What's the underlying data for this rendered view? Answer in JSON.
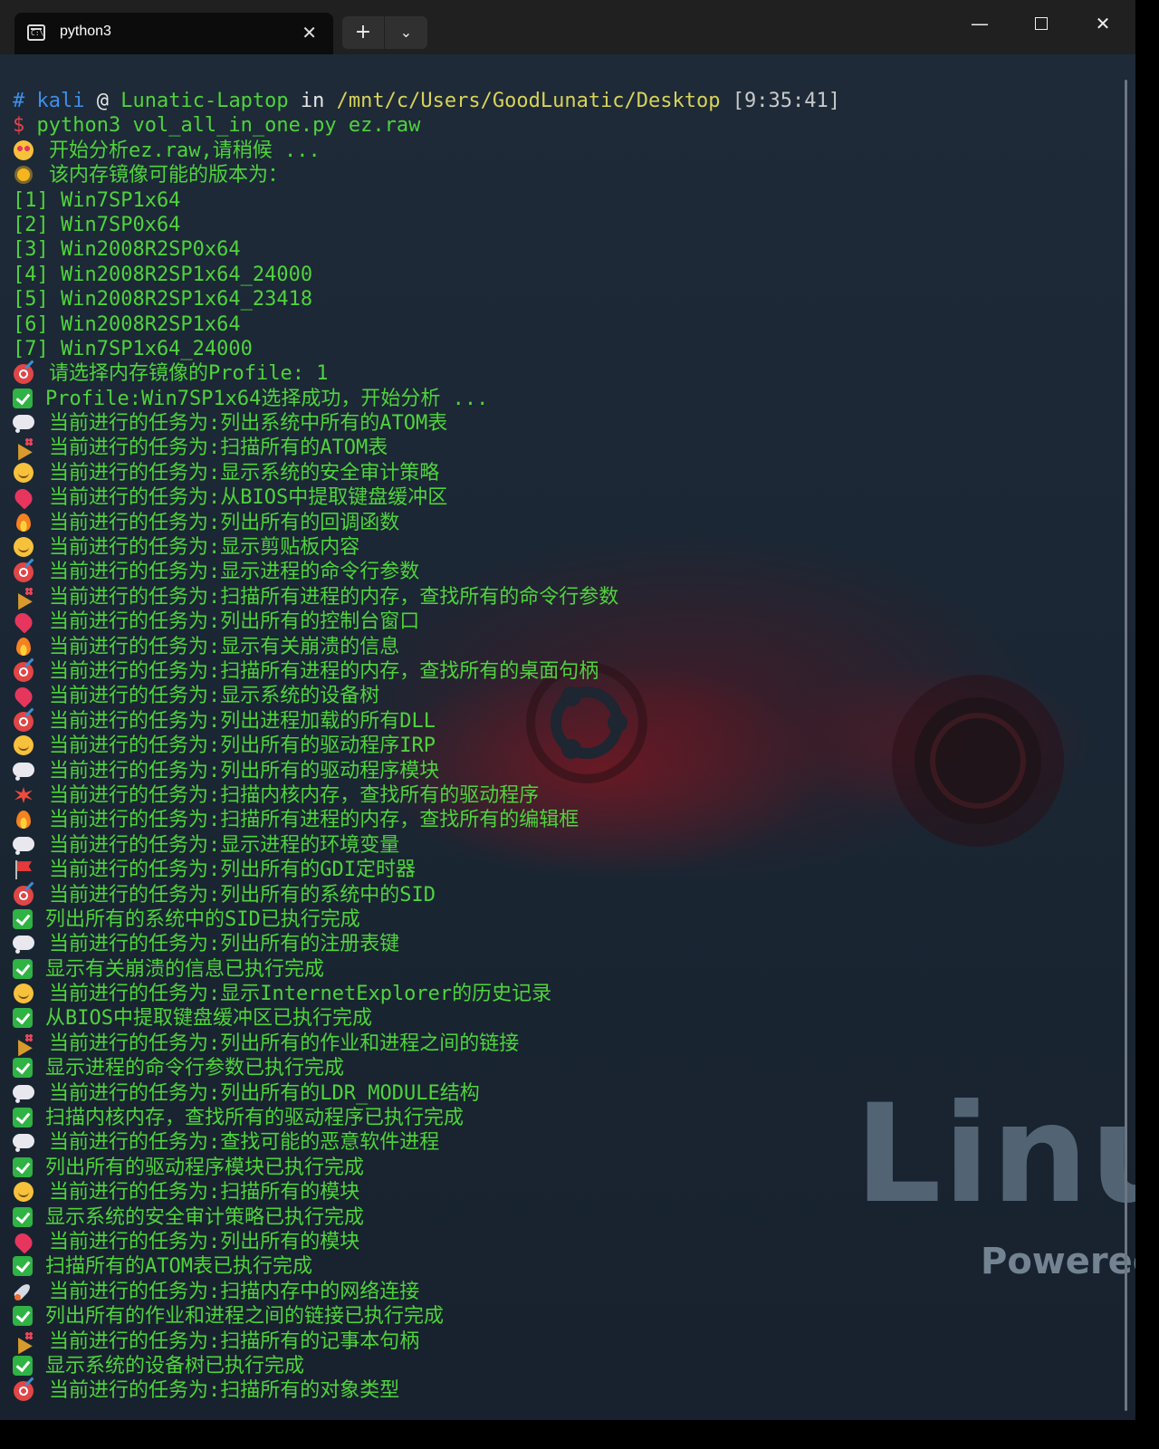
{
  "window": {
    "tab_title": "python3",
    "tab_icon_text": "C:\\",
    "new_tab_label": "+",
    "dropdown_label": "⌄",
    "close_tab_label": "✕",
    "minimize_label": "—",
    "close_label": "✕"
  },
  "wallpaper": {
    "line1": "Linux",
    "line2": "Powered"
  },
  "prompt": {
    "hash": "#",
    "user": "kali",
    "at": "@",
    "host": "Lunatic-Laptop",
    "in": "in",
    "path": "/mnt/c/Users/GoodLunatic/Desktop",
    "time": "[9:35:41]",
    "dollar": "$",
    "command": "python3 vol_all_in_one.py ez.raw"
  },
  "lines": [
    {
      "icon": "hearts",
      "text": "开始分析ez.raw,请稍候 ..."
    },
    {
      "icon": "sun",
      "text": "该内存镜像可能的版本为："
    },
    {
      "icon": "",
      "text": "[1] Win7SP1x64"
    },
    {
      "icon": "",
      "text": "[2] Win7SP0x64"
    },
    {
      "icon": "",
      "text": "[3] Win2008R2SP0x64"
    },
    {
      "icon": "",
      "text": "[4] Win2008R2SP1x64_24000"
    },
    {
      "icon": "",
      "text": "[5] Win2008R2SP1x64_23418"
    },
    {
      "icon": "",
      "text": "[6] Win2008R2SP1x64"
    },
    {
      "icon": "",
      "text": "[7] Win7SP1x64_24000"
    },
    {
      "icon": "target",
      "text": "请选择内存镜像的Profile: 1"
    },
    {
      "icon": "check",
      "text": "Profile:Win7SP1x64选择成功，开始分析 ..."
    },
    {
      "icon": "bubble",
      "text": "当前进行的任务为:列出系统中所有的ATOM表"
    },
    {
      "icon": "party",
      "text": "当前进行的任务为:扫描所有的ATOM表"
    },
    {
      "icon": "smile",
      "text": "当前进行的任务为:显示系统的安全审计策略"
    },
    {
      "icon": "heart",
      "text": "当前进行的任务为:从BIOS中提取键盘缓冲区"
    },
    {
      "icon": "fire",
      "text": "当前进行的任务为:列出所有的回调函数"
    },
    {
      "icon": "smile",
      "text": "当前进行的任务为:显示剪贴板内容"
    },
    {
      "icon": "target",
      "text": "当前进行的任务为:显示进程的命令行参数"
    },
    {
      "icon": "party",
      "text": "当前进行的任务为:扫描所有进程的内存，查找所有的命令行参数"
    },
    {
      "icon": "heart",
      "text": "当前进行的任务为:列出所有的控制台窗口"
    },
    {
      "icon": "fire",
      "text": "当前进行的任务为:显示有关崩溃的信息"
    },
    {
      "icon": "target",
      "text": "当前进行的任务为:扫描所有进程的内存，查找所有的桌面句柄"
    },
    {
      "icon": "heart",
      "text": "当前进行的任务为:显示系统的设备树"
    },
    {
      "icon": "target",
      "text": "当前进行的任务为:列出进程加载的所有DLL"
    },
    {
      "icon": "smile",
      "text": "当前进行的任务为:列出所有的驱动程序IRP"
    },
    {
      "icon": "bubble",
      "text": "当前进行的任务为:列出所有的驱动程序模块"
    },
    {
      "icon": "boom",
      "text": "当前进行的任务为:扫描内核内存，查找所有的驱动程序"
    },
    {
      "icon": "fire",
      "text": "当前进行的任务为:扫描所有进程的内存，查找所有的编辑框"
    },
    {
      "icon": "bubble",
      "text": "当前进行的任务为:显示进程的环境变量"
    },
    {
      "icon": "flag",
      "text": "当前进行的任务为:列出所有的GDI定时器"
    },
    {
      "icon": "target",
      "text": "当前进行的任务为:列出所有的系统中的SID"
    },
    {
      "icon": "check",
      "text": "列出所有的系统中的SID已执行完成"
    },
    {
      "icon": "bubble",
      "text": "当前进行的任务为:列出所有的注册表键"
    },
    {
      "icon": "check",
      "text": "显示有关崩溃的信息已执行完成"
    },
    {
      "icon": "smile",
      "text": "当前进行的任务为:显示InternetExplorer的历史记录"
    },
    {
      "icon": "check",
      "text": "从BIOS中提取键盘缓冲区已执行完成"
    },
    {
      "icon": "party",
      "text": "当前进行的任务为:列出所有的作业和进程之间的链接"
    },
    {
      "icon": "check",
      "text": "显示进程的命令行参数已执行完成"
    },
    {
      "icon": "bubble",
      "text": "当前进行的任务为:列出所有的LDR_MODULE结构"
    },
    {
      "icon": "check",
      "text": "扫描内核内存，查找所有的驱动程序已执行完成"
    },
    {
      "icon": "bubble",
      "text": "当前进行的任务为:查找可能的恶意软件进程"
    },
    {
      "icon": "check",
      "text": "列出所有的驱动程序模块已执行完成"
    },
    {
      "icon": "smile",
      "text": "当前进行的任务为:扫描所有的模块"
    },
    {
      "icon": "check",
      "text": "显示系统的安全审计策略已执行完成"
    },
    {
      "icon": "heart",
      "text": "当前进行的任务为:列出所有的模块"
    },
    {
      "icon": "check",
      "text": "扫描所有的ATOM表已执行完成"
    },
    {
      "icon": "rocket",
      "text": "当前进行的任务为:扫描内存中的网络连接"
    },
    {
      "icon": "check",
      "text": "列出所有的作业和进程之间的链接已执行完成"
    },
    {
      "icon": "party",
      "text": "当前进行的任务为:扫描所有的记事本句柄"
    },
    {
      "icon": "check",
      "text": "显示系统的设备树已执行完成"
    },
    {
      "icon": "target",
      "text": "当前进行的任务为:扫描所有的对象类型"
    }
  ],
  "colors": {
    "output_green": "#4fd33c",
    "prompt_blue": "#3f8fe8",
    "prompt_red": "#e0454a",
    "titlebar": "#202020"
  }
}
